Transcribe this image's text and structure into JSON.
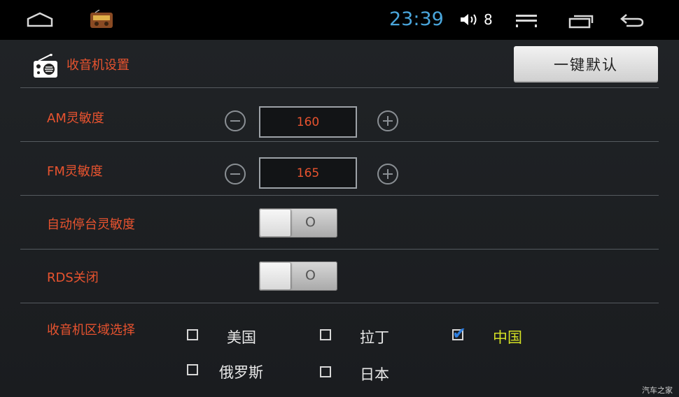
{
  "statusbar": {
    "time": "23:39",
    "volume_level": "8",
    "icons": [
      "home-icon",
      "radio-app-icon",
      "volume-icon",
      "menu-icon",
      "recent-apps-icon",
      "back-icon"
    ]
  },
  "header": {
    "title": "收音机设置",
    "default_button": "一键默认"
  },
  "settings": {
    "am": {
      "label": "AM灵敏度",
      "value": "160"
    },
    "fm": {
      "label": "FM灵敏度",
      "value": "165"
    },
    "auto_seek": {
      "label": "自动停台灵敏度",
      "state": "O",
      "on": false
    },
    "rds": {
      "label": "RDS关闭",
      "state": "O",
      "on": false
    }
  },
  "region": {
    "label": "收音机区域选择",
    "options": [
      {
        "label": "美国",
        "checked": false
      },
      {
        "label": "拉丁",
        "checked": false
      },
      {
        "label": "中国",
        "checked": true
      },
      {
        "label": "俄罗斯",
        "checked": false
      },
      {
        "label": "日本",
        "checked": false
      }
    ]
  },
  "watermark": "汽车之家",
  "colors": {
    "accent_label": "#e8532f",
    "clock": "#4aa6dc",
    "selected_region": "#d4e024",
    "checkmark": "#2f7fe0"
  }
}
